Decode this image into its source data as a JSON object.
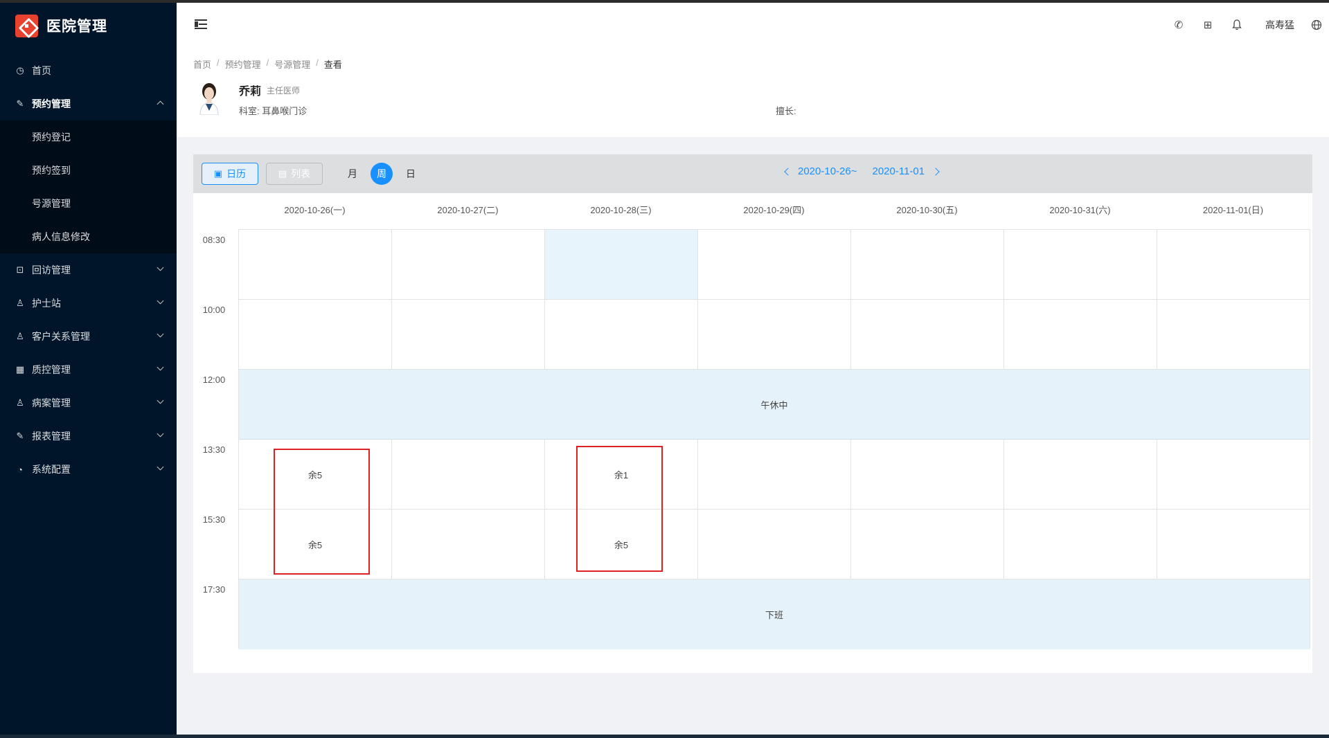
{
  "app": {
    "name": "医院管理"
  },
  "sidebar": {
    "items": [
      {
        "label": "首页",
        "icon": "clock-icon",
        "has_children": false
      },
      {
        "label": "预约管理",
        "icon": "edit-icon",
        "has_children": true,
        "open": true,
        "children": [
          "预约登记",
          "预约签到",
          "号源管理",
          "病人信息修改"
        ]
      },
      {
        "label": "回访管理",
        "icon": "lock-icon",
        "has_children": true
      },
      {
        "label": "护士站",
        "icon": "user-icon",
        "has_children": true
      },
      {
        "label": "客户关系管理",
        "icon": "user-icon",
        "has_children": true
      },
      {
        "label": "质控管理",
        "icon": "table-icon",
        "has_children": true
      },
      {
        "label": "病案管理",
        "icon": "user-icon",
        "has_children": true
      },
      {
        "label": "报表管理",
        "icon": "edit-icon",
        "has_children": true
      },
      {
        "label": "系统配置",
        "icon": "dashboard-icon",
        "has_children": true
      }
    ]
  },
  "header": {
    "username": "高寿猛"
  },
  "breadcrumb": [
    "首页",
    "预约管理",
    "号源管理",
    "查看"
  ],
  "doctor": {
    "name": "乔莉",
    "title": "主任医师",
    "dept": "科室: 耳鼻喉门诊",
    "skill": "擅长:"
  },
  "toolbar": {
    "calendar_label": "日历",
    "list_label": "列表",
    "views": [
      "月",
      "周",
      "日"
    ],
    "active_view": "周",
    "range_start": "2020-10-26~",
    "range_end": "2020-11-01"
  },
  "calendar": {
    "days": [
      "2020-10-26(一)",
      "2020-10-27(二)",
      "2020-10-28(三)",
      "2020-10-29(四)",
      "2020-10-30(五)",
      "2020-10-31(六)",
      "2020-11-01(日)"
    ],
    "times": [
      "08:30",
      "10:00",
      "12:00",
      "13:30",
      "15:30",
      "17:30"
    ],
    "lunch_label": "午休中",
    "off_label": "下班",
    "slots": [
      {
        "day": 0,
        "row": 3,
        "text": "余5"
      },
      {
        "day": 0,
        "row": 4,
        "text": "余5"
      },
      {
        "day": 2,
        "row": 3,
        "text": "余1"
      },
      {
        "day": 2,
        "row": 4,
        "text": "余5"
      }
    ]
  },
  "colors": {
    "accent": "#1890ff",
    "sidebar": "#001529",
    "highlight": "#e8f4fb",
    "marker": "#e02020"
  }
}
